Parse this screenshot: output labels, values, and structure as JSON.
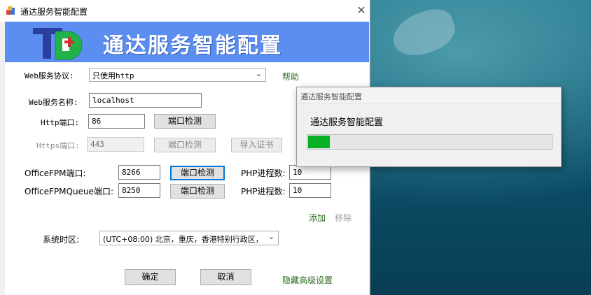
{
  "window": {
    "title": "通达服务智能配置",
    "close_glyph": "✕"
  },
  "banner": {
    "logo_letters": "TD",
    "title": "通达服务智能配置"
  },
  "form": {
    "protocol_label": "Web服务协议:",
    "protocol_value": "只使用http",
    "help_link": "帮助",
    "service_name_label": "Web服务名称:",
    "service_name_value": "localhost",
    "http_port_label": "Http端口:",
    "http_port_value": "86",
    "http_check_label": "端口检测",
    "https_port_label": "Https端口:",
    "https_port_value": "443",
    "https_check_label": "端口检测",
    "import_cert_label": "导入证书",
    "fpm_label": "OfficeFPM端口:",
    "fpm_value": "8266",
    "fpm_check_label": "端口检测",
    "fpm_php_label": "PHP进程数:",
    "fpm_php_value": "10",
    "queue_label": "OfficeFPMQueue端口:",
    "queue_value": "8250",
    "queue_check_label": "端口检测",
    "queue_php_label": "PHP进程数:",
    "queue_php_value": "10",
    "add_link": "添加",
    "remove_link": "移除",
    "timezone_label": "系统时区:",
    "timezone_value": "(UTC+08:00) 北京，重庆，香港特别行政区，"
  },
  "footer": {
    "ok_label": "确定",
    "cancel_label": "取消",
    "advanced_link": "隐藏高级设置"
  },
  "progress_dialog": {
    "title": "通达服务智能配置",
    "message": "通达服务智能配置",
    "progress": 0.09
  },
  "colors": {
    "banner": "#5c8ef2",
    "link": "#2f6b20",
    "progress": "#06b025"
  },
  "icons": {
    "app": "app-icon",
    "chevron": "chevron-down-icon"
  }
}
